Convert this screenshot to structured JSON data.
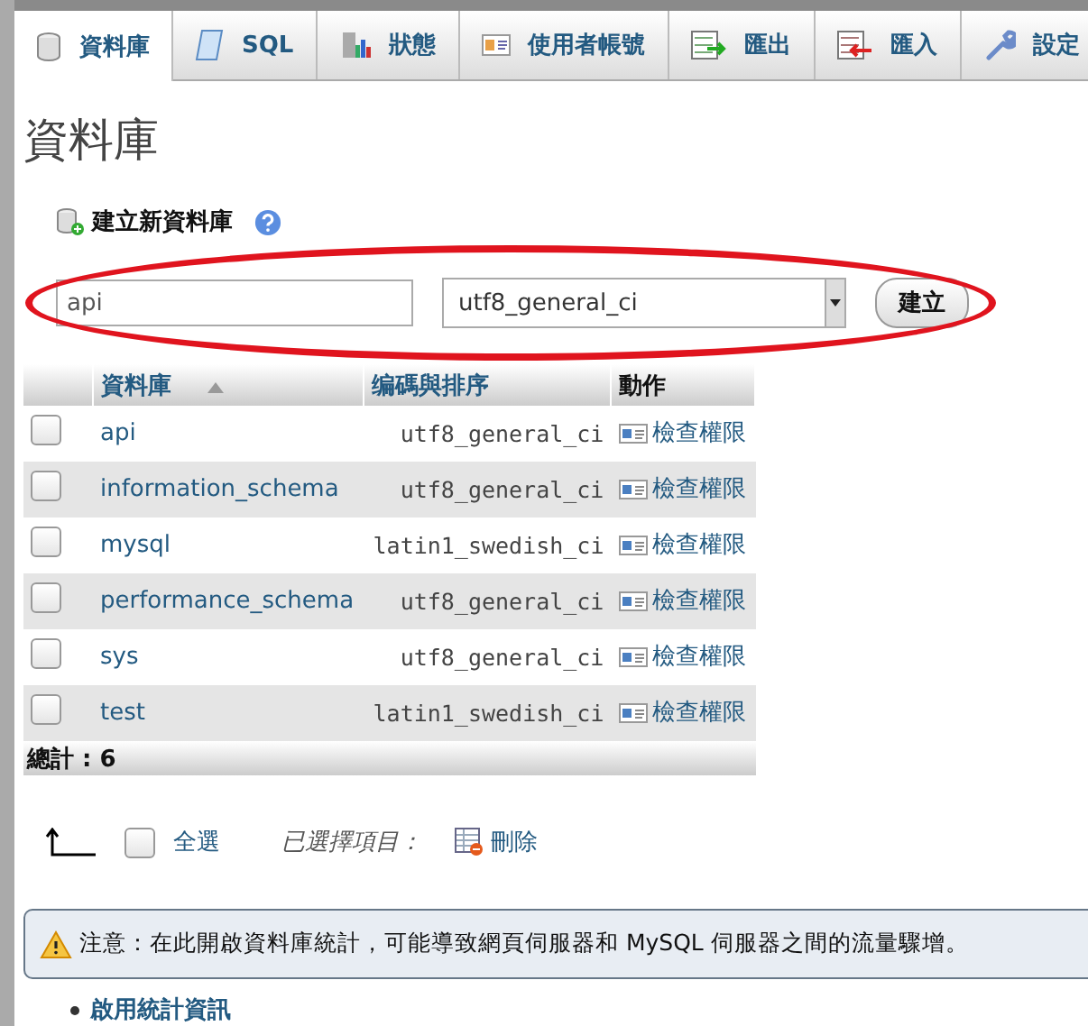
{
  "tabs": [
    {
      "label": "資料庫",
      "selected": true
    },
    {
      "label": "SQL",
      "selected": false
    },
    {
      "label": "狀態",
      "selected": false
    },
    {
      "label": "使用者帳號",
      "selected": false
    },
    {
      "label": "匯出",
      "selected": false
    },
    {
      "label": "匯入",
      "selected": false
    },
    {
      "label": "設定",
      "selected": false
    }
  ],
  "page_title": "資料庫",
  "create_heading": "建立新資料庫",
  "create_form": {
    "name_value": "api",
    "collation_value": "utf8_general_ci",
    "submit": "建立"
  },
  "table": {
    "columns": [
      {
        "label": "資料庫",
        "sorted": true
      },
      {
        "label": "编碼與排序",
        "sorted": false
      },
      {
        "label": "動作",
        "sorted": false
      }
    ],
    "rows": [
      {
        "name": "api",
        "collation": "utf8_general_ci",
        "action": "檢查權限",
        "checked": false
      },
      {
        "name": "information_schema",
        "collation": "utf8_general_ci",
        "action": "檢查權限",
        "checked": false
      },
      {
        "name": "mysql",
        "collation": "latin1_swedish_ci",
        "action": "檢查權限",
        "checked": false
      },
      {
        "name": "performance_schema",
        "collation": "utf8_general_ci",
        "action": "檢查權限",
        "checked": false
      },
      {
        "name": "sys",
        "collation": "utf8_general_ci",
        "action": "檢查權限",
        "checked": false
      },
      {
        "name": "test",
        "collation": "latin1_swedish_ci",
        "action": "檢查權限",
        "checked": false
      }
    ],
    "total_label": "總計 :",
    "total_value": "6"
  },
  "bulk": {
    "select_all": "全選",
    "select_all_checked": false,
    "with_selected": "已選擇項目：",
    "delete": "刪除"
  },
  "notice": "注意：在此開啟資料庫統計，可能導致網頁伺服器和 MySQL 伺服器之間的流量驟增。",
  "enable_stats_link": "啟用統計資訊"
}
